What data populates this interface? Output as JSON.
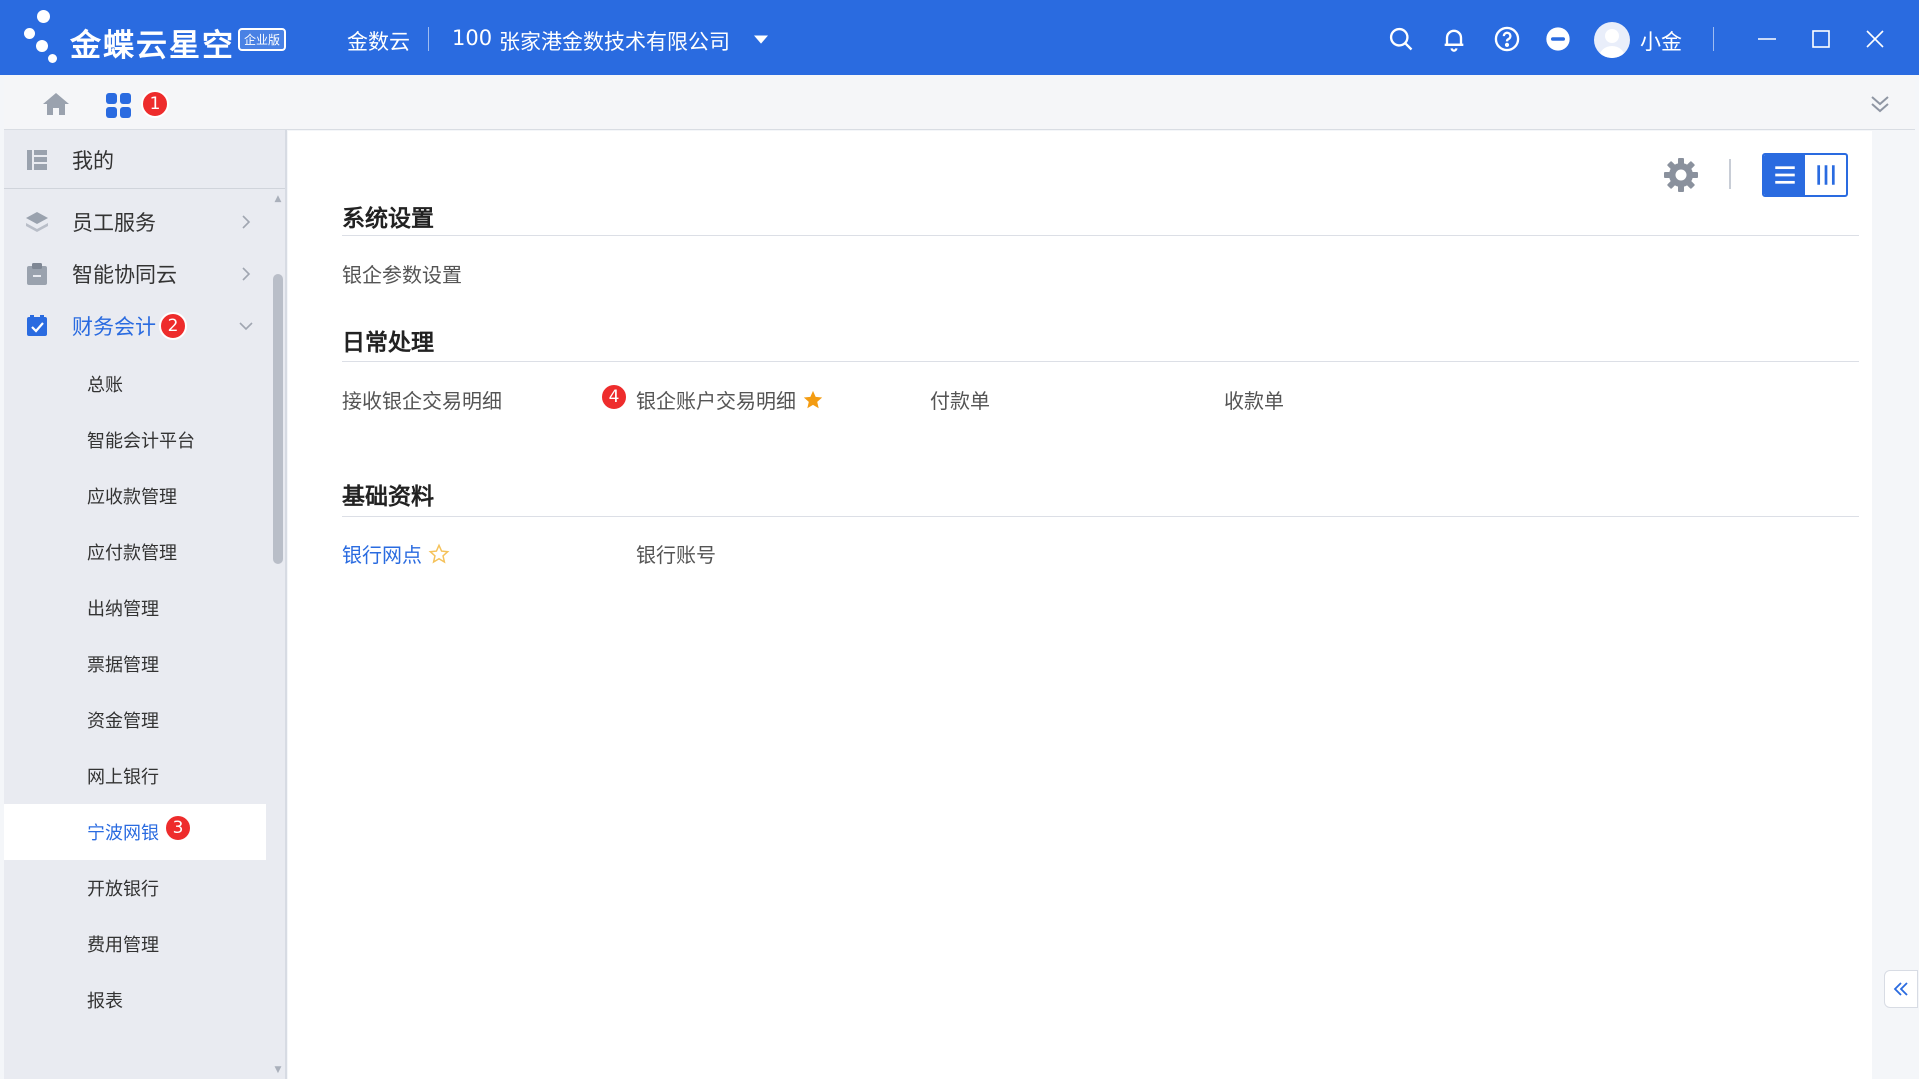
{
  "brand": {
    "name": "金蝶云星空",
    "edition": "企业版"
  },
  "titlebar": {
    "cloud_label": "金数云",
    "org_code": "100",
    "org_name": "张家港金数技术有限公司",
    "user_name": "小金",
    "icons": [
      "search-icon",
      "bell-icon",
      "help-icon",
      "more-icon",
      "avatar",
      "minimize-icon",
      "maximize-icon",
      "close-icon"
    ]
  },
  "tabbar": {
    "badge": "1"
  },
  "sidebar": {
    "items": [
      {
        "label": "我的",
        "icon": "my-icon"
      },
      {
        "label": "员工服务",
        "icon": "layers-icon"
      },
      {
        "label": "智能协同云",
        "icon": "clipboard-icon"
      },
      {
        "label": "财务会计",
        "icon": "finance-icon",
        "badge": "2",
        "expanded": true
      }
    ],
    "sub_items": [
      {
        "label": "总账"
      },
      {
        "label": "智能会计平台"
      },
      {
        "label": "应收款管理"
      },
      {
        "label": "应付款管理"
      },
      {
        "label": "出纳管理"
      },
      {
        "label": "票据管理"
      },
      {
        "label": "资金管理"
      },
      {
        "label": "网上银行"
      },
      {
        "label": "宁波网银",
        "badge": "3",
        "active": true
      },
      {
        "label": "开放银行"
      },
      {
        "label": "费用管理"
      },
      {
        "label": "报表"
      }
    ]
  },
  "content": {
    "sections": [
      {
        "title": "系统设置",
        "links": [
          {
            "label": "银企参数设置"
          }
        ]
      },
      {
        "title": "日常处理",
        "links": [
          {
            "label": "接收银企交易明细"
          },
          {
            "label": "银企账户交易明细",
            "badge": "4",
            "starred": true
          },
          {
            "label": "付款单"
          },
          {
            "label": "收款单"
          }
        ]
      },
      {
        "title": "基础资料",
        "links": [
          {
            "label": "银行网点",
            "starred": false,
            "highlighted": true
          },
          {
            "label": "银行账号"
          }
        ]
      }
    ]
  },
  "colors": {
    "primary": "#2a6be0",
    "badge": "#ee2c2c",
    "star": "#f39c12"
  }
}
